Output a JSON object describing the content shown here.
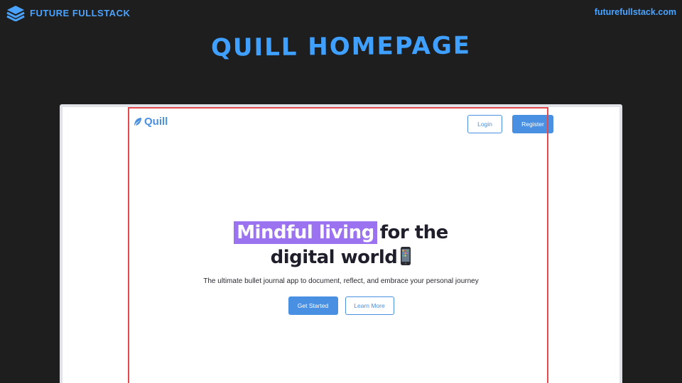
{
  "brand": {
    "name": "FUTURE FULLSTACK",
    "url": "futurefullstack.com",
    "accent_color": "#4aa3ff",
    "icon": "stacked-layers-icon"
  },
  "slide": {
    "title": "QUILL HOMEPAGE",
    "title_color": "#3fa0ff",
    "background_color": "#1e1e1e"
  },
  "screenshot": {
    "highlight_color": "#e5484d",
    "site": {
      "logo_text": "Quill",
      "logo_icon": "leaf-icon",
      "nav": {
        "login_label": "Login",
        "register_label": "Register"
      },
      "hero": {
        "highlight_text": "Mindful living",
        "title_rest_line1": "for the",
        "title_line2": "digital world",
        "emoji_icon": "mobile-phone-icon",
        "highlight_color": "#9b72f0",
        "subtitle": "The ultimate bullet journal app to document, reflect, and embrace your personal journey",
        "primary_cta": "Get Started",
        "secondary_cta": "Learn More"
      },
      "primary_color": "#4a90e2"
    }
  }
}
